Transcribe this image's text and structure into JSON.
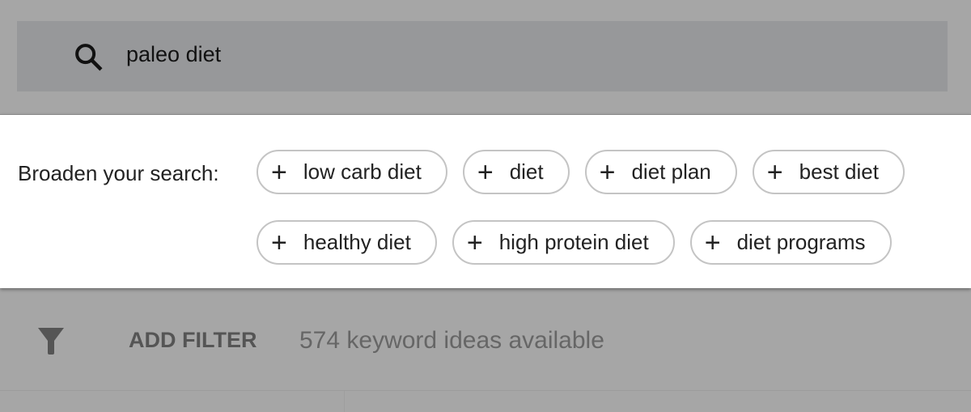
{
  "search": {
    "icon": "search-icon",
    "query": "paleo diet"
  },
  "broaden": {
    "label": "Broaden your search:",
    "chips": [
      {
        "label": "low carb diet"
      },
      {
        "label": "diet"
      },
      {
        "label": "diet plan"
      },
      {
        "label": "best diet"
      },
      {
        "label": "healthy diet"
      },
      {
        "label": "high protein diet"
      },
      {
        "label": "diet programs"
      }
    ],
    "chip_icon": "+"
  },
  "filter": {
    "icon": "filter-icon",
    "add_label": "ADD FILTER",
    "count_text": "574 keyword ideas available"
  },
  "colors": {
    "overlay": "#a6a6a6",
    "search_bg": "#97989a",
    "chip_border": "#c4c4c4"
  }
}
